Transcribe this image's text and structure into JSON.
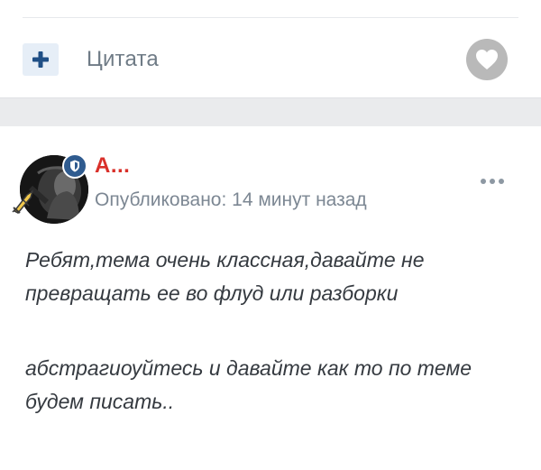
{
  "action_bar": {
    "quote_label": "Цитата",
    "plus_icon": "plus-icon",
    "like_icon": "heart-icon"
  },
  "post": {
    "author": "A...",
    "meta": "Опубликовано: 14 минут назад",
    "menu_icon": "more-horizontal-icon",
    "body": {
      "paragraph1_line1": "Ребят,тема очень классная,давайте не",
      "paragraph1_line2": "превращать ее во флуд или разборки",
      "paragraph2_line1": "абстрагиоуйтесь и давайте как то по теме",
      "paragraph2_line2": "будем писать.."
    }
  },
  "colors": {
    "author_red": "#d9302a",
    "quote_button_bg": "#e6eef7",
    "plus_blue": "#1f4f86",
    "like_gray": "#b9b9b9",
    "separator": "#eaebed",
    "meta_gray": "#7c8793"
  }
}
